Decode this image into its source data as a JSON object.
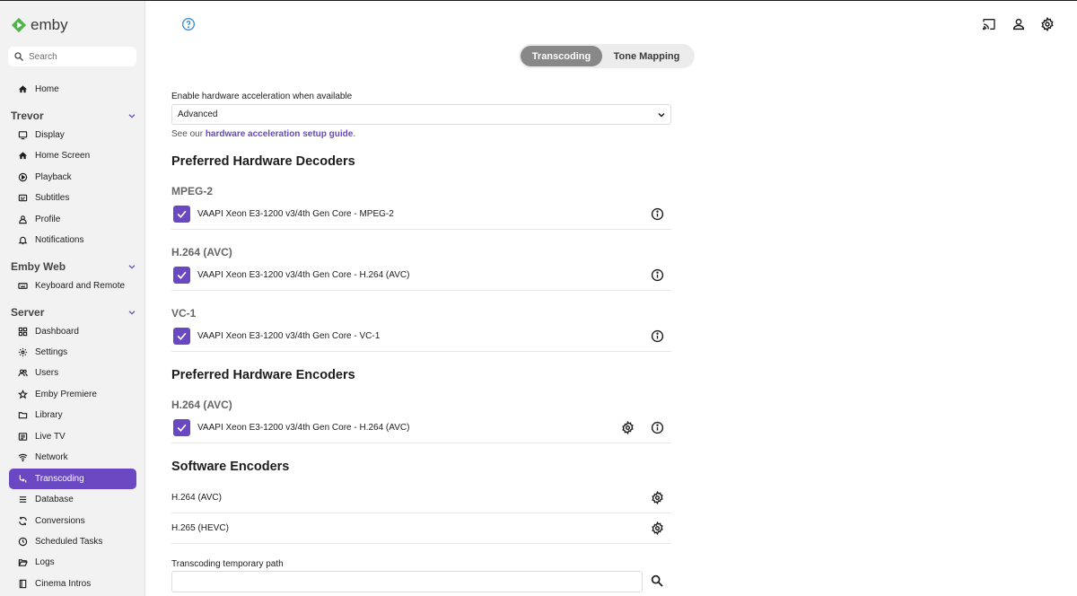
{
  "app": {
    "logo_text": "emby"
  },
  "search": {
    "placeholder": "Search"
  },
  "sidebar": {
    "home": "Home",
    "groups": [
      {
        "label": "Trevor",
        "items": [
          "Display",
          "Home Screen",
          "Playback",
          "Subtitles",
          "Profile",
          "Notifications"
        ]
      },
      {
        "label": "Emby Web",
        "items": [
          "Keyboard and Remote"
        ]
      },
      {
        "label": "Server",
        "items": [
          "Dashboard",
          "Settings",
          "Users",
          "Emby Premiere",
          "Library",
          "Live TV",
          "Network",
          "Transcoding",
          "Database",
          "Conversions",
          "Scheduled Tasks",
          "Logs",
          "Cinema Intros"
        ]
      }
    ],
    "active_item": "Transcoding"
  },
  "header_icons": [
    "help-icon",
    "cast-icon",
    "user-icon",
    "settings-icon"
  ],
  "tabs": {
    "transcoding": "Transcoding",
    "tone_mapping": "Tone Mapping",
    "active": "Transcoding"
  },
  "hw_accel": {
    "label": "Enable hardware acceleration when available",
    "value": "Advanced",
    "help_prefix": "See our ",
    "help_link": "hardware acceleration setup guide",
    "help_suffix": "."
  },
  "decoders": {
    "title": "Preferred Hardware Decoders",
    "groups": [
      {
        "codec": "MPEG-2",
        "item": "VAAPI Xeon E3-1200 v3/4th Gen Core - MPEG-2",
        "checked": true
      },
      {
        "codec": "H.264 (AVC)",
        "item": "VAAPI Xeon E3-1200 v3/4th Gen Core - H.264 (AVC)",
        "checked": true
      },
      {
        "codec": "VC-1",
        "item": "VAAPI Xeon E3-1200 v3/4th Gen Core - VC-1",
        "checked": true
      }
    ]
  },
  "encoders": {
    "title": "Preferred Hardware Encoders",
    "groups": [
      {
        "codec": "H.264 (AVC)",
        "item": "VAAPI Xeon E3-1200 v3/4th Gen Core - H.264 (AVC)",
        "checked": true
      }
    ]
  },
  "software": {
    "title": "Software Encoders",
    "items": [
      "H.264 (AVC)",
      "H.265 (HEVC)"
    ]
  },
  "temp_path": {
    "label": "Transcoding temporary path",
    "value": ""
  },
  "colors": {
    "accent": "#6a48c1",
    "sidebar_bg": "#f2f2f2",
    "tab_active": "#888888"
  }
}
